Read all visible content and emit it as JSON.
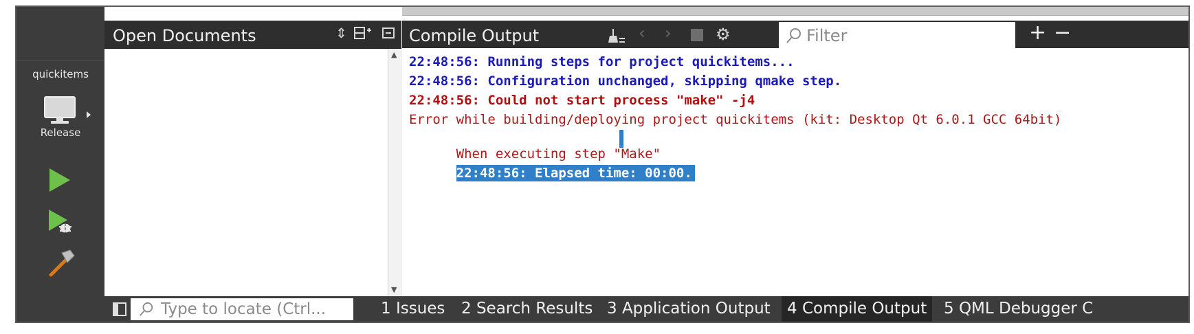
{
  "modebar": {
    "project_name": "quickitems",
    "build_config": "Release"
  },
  "open_documents": {
    "title": "Open Documents",
    "items": []
  },
  "compile_output": {
    "title": "Compile Output",
    "filter_placeholder": "Filter",
    "lines": [
      "22:48:56: Running steps for project quickitems...",
      "22:48:56: Configuration unchanged, skipping qmake step.",
      "22:48:56: Could not start process \"make\" -j4",
      "Error while building/deploying project quickitems (kit: Desktop Qt 6.0.1 GCC 64bit)",
      "When executing step \"Make\"",
      "22:48:56: Elapsed time: 00:00."
    ],
    "colors": {
      "info": "#1a1ab8",
      "error": "#b01010",
      "selection": "#2f80c8"
    }
  },
  "statusbar": {
    "locator_placeholder": "Type to locate (Ctrl...",
    "panes": [
      {
        "label": "1 Issues",
        "active": false
      },
      {
        "label": "2 Search Results",
        "active": false
      },
      {
        "label": "3 Application Output",
        "active": false
      },
      {
        "label": "4 Compile Output",
        "active": true
      },
      {
        "label": "5 QML Debugger C",
        "active": false
      }
    ]
  }
}
